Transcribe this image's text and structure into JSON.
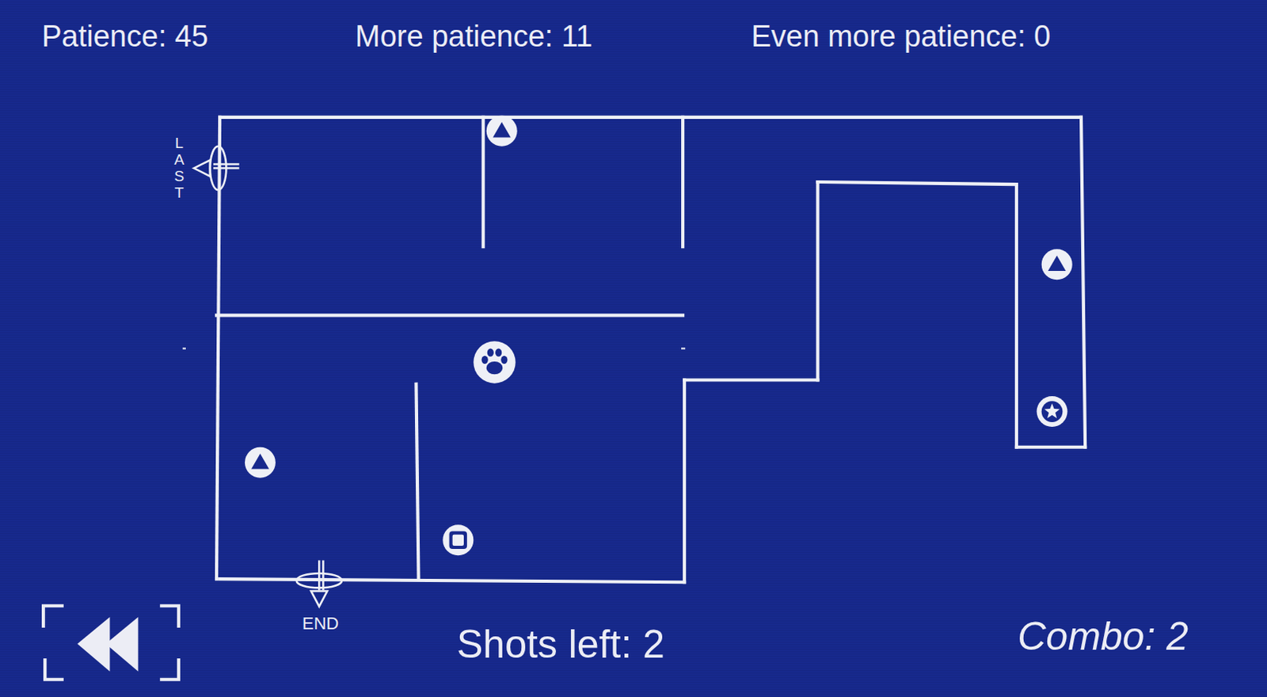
{
  "hud": {
    "stats": [
      {
        "label": "Patience: 45"
      },
      {
        "label": "More patience: 11"
      },
      {
        "label": "Even more patience: 0"
      }
    ],
    "shots": "Shots left: 2",
    "combo": "Combo: 2"
  },
  "map": {
    "doors": [
      {
        "label": "LAST",
        "kind": "exit-left"
      },
      {
        "label": "END",
        "kind": "exit-down"
      }
    ],
    "markers": [
      {
        "kind": "triangle"
      },
      {
        "kind": "triangle"
      },
      {
        "kind": "triangle"
      },
      {
        "kind": "star"
      },
      {
        "kind": "square"
      },
      {
        "kind": "paw"
      }
    ]
  }
}
